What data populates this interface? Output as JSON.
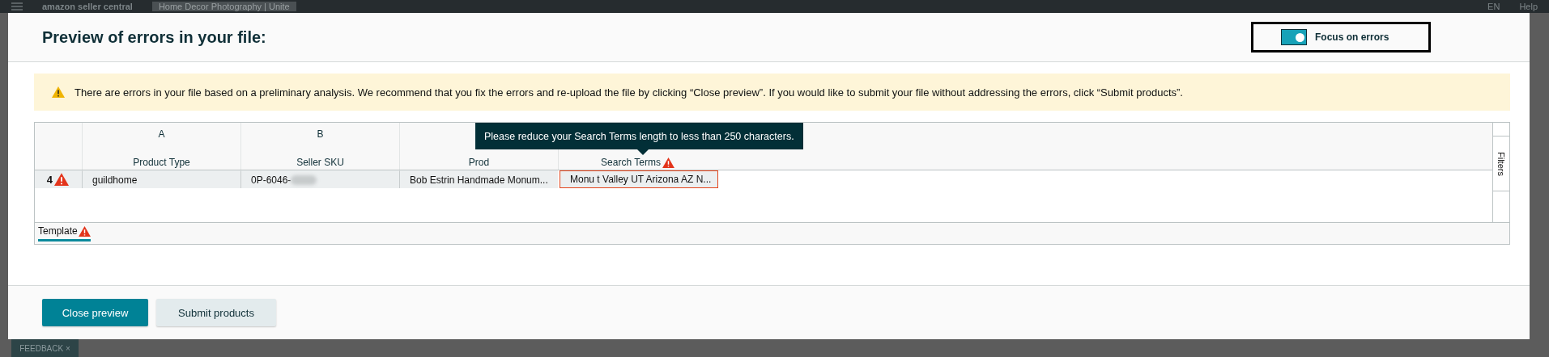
{
  "background": {
    "logo": "amazon seller central",
    "tab": "Home Decor Photography | Unite",
    "language": "EN",
    "help": "Help",
    "feedback": {
      "label": "FEEDBACK",
      "close": "×"
    }
  },
  "dialog": {
    "title": "Preview of errors in your file:",
    "focus_toggle": {
      "label": "Focus on errors",
      "on": true
    },
    "alert": "There are errors in your file based on a preliminary analysis. We recommend that you fix the errors and re-upload the file by clicking “Close preview”. If you would like to submit your file without addressing the errors, click “Submit products”.",
    "table": {
      "columns": [
        {
          "letter": "A",
          "name": "Product Type",
          "error": false
        },
        {
          "letter": "B",
          "name": "Seller SKU",
          "error": false
        },
        {
          "name": "Prod",
          "error": false
        },
        {
          "name": "Search Terms",
          "error": true
        }
      ],
      "rows": [
        {
          "number": "4",
          "error": true,
          "cells": [
            {
              "value": "guildhome",
              "error": false,
              "redacted": false
            },
            {
              "value": "0P-6046-",
              "error": false,
              "redacted": true
            },
            {
              "value": "Bob Estrin Handmade Monum...",
              "error": false,
              "redacted": false
            },
            {
              "value": "Monu t Valley UT Arizona AZ N...",
              "error": true,
              "redacted": false
            }
          ]
        }
      ],
      "tooltip": "Please reduce your Search Terms length to less than 250 characters.",
      "filters": "Filters",
      "sheets": [
        {
          "name": "Template",
          "error": true,
          "selected": true
        }
      ]
    },
    "buttons": [
      {
        "label": "Close preview",
        "kind": "primary"
      },
      {
        "label": "Submit products",
        "kind": "secondary"
      }
    ]
  }
}
